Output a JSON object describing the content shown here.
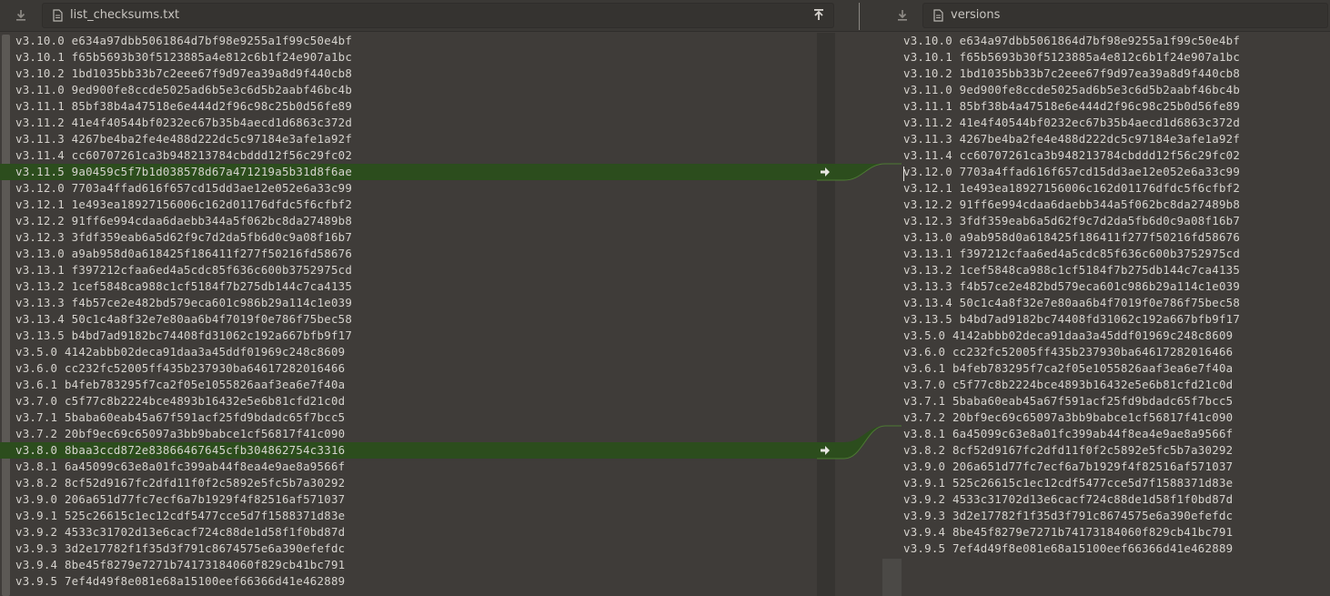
{
  "left_file": {
    "name": "list_checksums.txt"
  },
  "right_file": {
    "name": "versions"
  },
  "icons": {
    "download": "download-arrow-icon",
    "file": "file-icon",
    "upload": "upload-arrow-icon",
    "copy_change": "push-change-arrow-icon"
  },
  "colors": {
    "changed_bg": "#2c4d1d",
    "text": "#d6d3ce",
    "background": "#3f3c39"
  },
  "left_lines": [
    {
      "text": "v3.10.0 e634a97dbb5061864d7bf98e9255a1f99c50e4bf",
      "changed": false
    },
    {
      "text": "v3.10.1 f65b5693b30f5123885a4e812c6b1f24e907a1bc",
      "changed": false
    },
    {
      "text": "v3.10.2 1bd1035bb33b7c2eee67f9d97ea39a8d9f440cb8",
      "changed": false
    },
    {
      "text": "v3.11.0 9ed900fe8ccde5025ad6b5e3c6d5b2aabf46bc4b",
      "changed": false
    },
    {
      "text": "v3.11.1 85bf38b4a47518e6e444d2f96c98c25b0d56fe89",
      "changed": false
    },
    {
      "text": "v3.11.2 41e4f40544bf0232ec67b35b4aecd1d6863c372d",
      "changed": false
    },
    {
      "text": "v3.11.3 4267be4ba2fe4e488d222dc5c97184e3afe1a92f",
      "changed": false
    },
    {
      "text": "v3.11.4 cc60707261ca3b948213784cbddd12f56c29fc02",
      "changed": false
    },
    {
      "text": "v3.11.5 9a0459c5f7b1d038578d67a471219a5b31d8f6ae",
      "changed": true
    },
    {
      "text": "v3.12.0 7703a4ffad616f657cd15dd3ae12e052e6a33c99",
      "changed": false
    },
    {
      "text": "v3.12.1 1e493ea18927156006c162d01176dfdc5f6cfbf2",
      "changed": false
    },
    {
      "text": "v3.12.2 91ff6e994cdaa6daebb344a5f062bc8da27489b8",
      "changed": false
    },
    {
      "text": "v3.12.3 3fdf359eab6a5d62f9c7d2da5fb6d0c9a08f16b7",
      "changed": false
    },
    {
      "text": "v3.13.0 a9ab958d0a618425f186411f277f50216fd58676",
      "changed": false
    },
    {
      "text": "v3.13.1 f397212cfaa6ed4a5cdc85f636c600b3752975cd",
      "changed": false
    },
    {
      "text": "v3.13.2 1cef5848ca988c1cf5184f7b275db144c7ca4135",
      "changed": false
    },
    {
      "text": "v3.13.3 f4b57ce2e482bd579eca601c986b29a114c1e039",
      "changed": false
    },
    {
      "text": "v3.13.4 50c1c4a8f32e7e80aa6b4f7019f0e786f75bec58",
      "changed": false
    },
    {
      "text": "v3.13.5 b4bd7ad9182bc74408fd31062c192a667bfb9f17",
      "changed": false
    },
    {
      "text": "v3.5.0 4142abbb02deca91daa3a45ddf01969c248c8609",
      "changed": false
    },
    {
      "text": "v3.6.0 cc232fc52005ff435b237930ba64617282016466",
      "changed": false
    },
    {
      "text": "v3.6.1 b4feb783295f7ca2f05e1055826aaf3ea6e7f40a",
      "changed": false
    },
    {
      "text": "v3.7.0 c5f77c8b2224bce4893b16432e5e6b81cfd21c0d",
      "changed": false
    },
    {
      "text": "v3.7.1 5baba60eab45a67f591acf25fd9bdadc65f7bcc5",
      "changed": false
    },
    {
      "text": "v3.7.2 20bf9ec69c65097a3bb9babce1cf56817f41c090",
      "changed": false
    },
    {
      "text": "v3.8.0 8baa3ccd872e83866467645cfb304862754c3316",
      "changed": true
    },
    {
      "text": "v3.8.1 6a45099c63e8a01fc399ab44f8ea4e9ae8a9566f",
      "changed": false
    },
    {
      "text": "v3.8.2 8cf52d9167fc2dfd11f0f2c5892e5fc5b7a30292",
      "changed": false
    },
    {
      "text": "v3.9.0 206a651d77fc7ecf6a7b1929f4f82516af571037",
      "changed": false
    },
    {
      "text": "v3.9.1 525c26615c1ec12cdf5477cce5d7f1588371d83e",
      "changed": false
    },
    {
      "text": "v3.9.2 4533c31702d13e6cacf724c88de1d58f1f0bd87d",
      "changed": false
    },
    {
      "text": "v3.9.3 3d2e17782f1f35d3f791c8674575e6a390efefdc",
      "changed": false
    },
    {
      "text": "v3.9.4 8be45f8279e7271b74173184060f829cb41bc791",
      "changed": false
    },
    {
      "text": "v3.9.5 7ef4d49f8e081e68a15100eef66366d41e462889",
      "changed": false
    }
  ],
  "right_lines": [
    "v3.10.0 e634a97dbb5061864d7bf98e9255a1f99c50e4bf",
    "v3.10.1 f65b5693b30f5123885a4e812c6b1f24e907a1bc",
    "v3.10.2 1bd1035bb33b7c2eee67f9d97ea39a8d9f440cb8",
    "v3.11.0 9ed900fe8ccde5025ad6b5e3c6d5b2aabf46bc4b",
    "v3.11.1 85bf38b4a47518e6e444d2f96c98c25b0d56fe89",
    "v3.11.2 41e4f40544bf0232ec67b35b4aecd1d6863c372d",
    "v3.11.3 4267be4ba2fe4e488d222dc5c97184e3afe1a92f",
    "v3.11.4 cc60707261ca3b948213784cbddd12f56c29fc02",
    "v3.12.0 7703a4ffad616f657cd15dd3ae12e052e6a33c99",
    "v3.12.1 1e493ea18927156006c162d01176dfdc5f6cfbf2",
    "v3.12.2 91ff6e994cdaa6daebb344a5f062bc8da27489b8",
    "v3.12.3 3fdf359eab6a5d62f9c7d2da5fb6d0c9a08f16b7",
    "v3.13.0 a9ab958d0a618425f186411f277f50216fd58676",
    "v3.13.1 f397212cfaa6ed4a5cdc85f636c600b3752975cd",
    "v3.13.2 1cef5848ca988c1cf5184f7b275db144c7ca4135",
    "v3.13.3 f4b57ce2e482bd579eca601c986b29a114c1e039",
    "v3.13.4 50c1c4a8f32e7e80aa6b4f7019f0e786f75bec58",
    "v3.13.5 b4bd7ad9182bc74408fd31062c192a667bfb9f17",
    "v3.5.0 4142abbb02deca91daa3a45ddf01969c248c8609",
    "v3.6.0 cc232fc52005ff435b237930ba64617282016466",
    "v3.6.1 b4feb783295f7ca2f05e1055826aaf3ea6e7f40a",
    "v3.7.0 c5f77c8b2224bce4893b16432e5e6b81cfd21c0d",
    "v3.7.1 5baba60eab45a67f591acf25fd9bdadc65f7bcc5",
    "v3.7.2 20bf9ec69c65097a3bb9babce1cf56817f41c090",
    "v3.8.1 6a45099c63e8a01fc399ab44f8ea4e9ae8a9566f",
    "v3.8.2 8cf52d9167fc2dfd11f0f2c5892e5fc5b7a30292",
    "v3.9.0 206a651d77fc7ecf6a7b1929f4f82516af571037",
    "v3.9.1 525c26615c1ec12cdf5477cce5d7f1588371d83e",
    "v3.9.2 4533c31702d13e6cacf724c88de1d58f1f0bd87d",
    "v3.9.3 3d2e17782f1f35d3f791c8674575e6a390efefdc",
    "v3.9.4 8be45f8279e7271b74173184060f829cb41bc791",
    "v3.9.5 7ef4d49f8e081e68a15100eef66366d41e462889"
  ]
}
